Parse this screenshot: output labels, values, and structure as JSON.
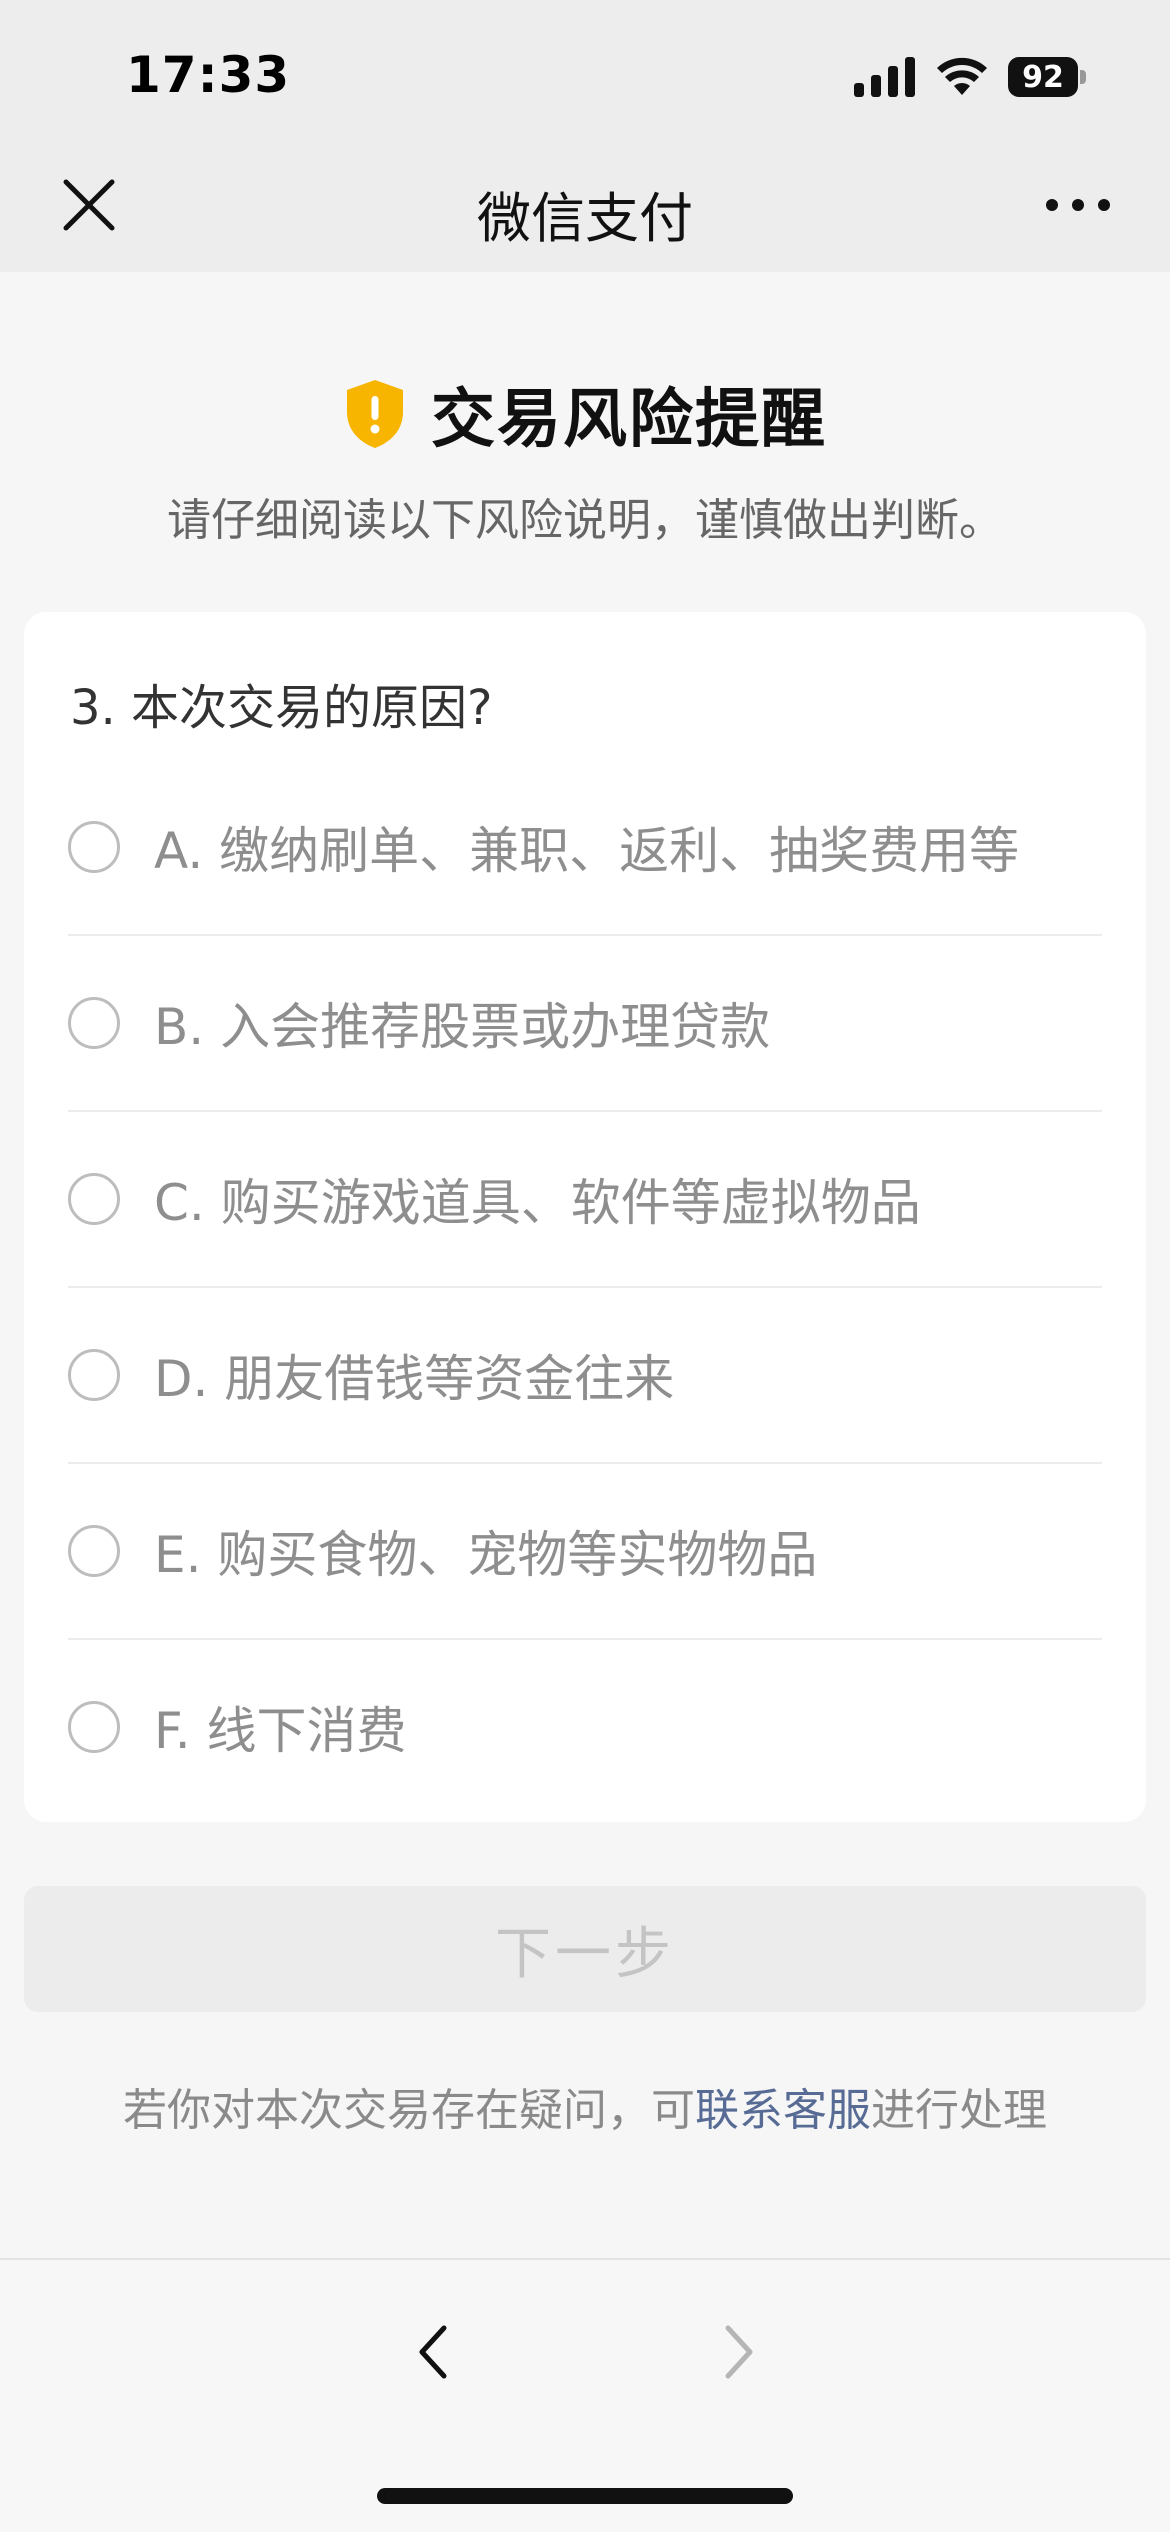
{
  "status_bar": {
    "time": "17:33",
    "battery_level": "92",
    "icons": [
      "signal-icon",
      "wifi-icon",
      "battery-icon"
    ]
  },
  "nav": {
    "title": "微信支付",
    "close_icon": "close-icon",
    "more_icon": "more-icon"
  },
  "header": {
    "title": "交易风险提醒",
    "subtitle": "请仔细阅读以下风险说明，谨慎做出判断。",
    "icon": "shield-warning-icon",
    "icon_color": "#f7b500"
  },
  "question": {
    "text": "3. 本次交易的原因?",
    "options": [
      {
        "label": "A. 缴纳刷单、兼职、返利、抽奖费用等",
        "selected": false
      },
      {
        "label": "B. 入会推荐股票或办理贷款",
        "selected": false
      },
      {
        "label": "C. 购买游戏道具、软件等虚拟物品",
        "selected": false
      },
      {
        "label": "D. 朋友借钱等资金往来",
        "selected": false
      },
      {
        "label": "E. 购买食物、宠物等实物物品",
        "selected": false
      },
      {
        "label": "F. 线下消费",
        "selected": false
      }
    ]
  },
  "actions": {
    "next_label": "下一步"
  },
  "help": {
    "prefix": "若你对本次交易存在疑问，可",
    "link": "联系客服",
    "suffix": "进行处理",
    "link_color": "#576b95"
  },
  "toolbar": {
    "back_icon": "chevron-left-icon",
    "forward_icon": "chevron-right-icon"
  }
}
